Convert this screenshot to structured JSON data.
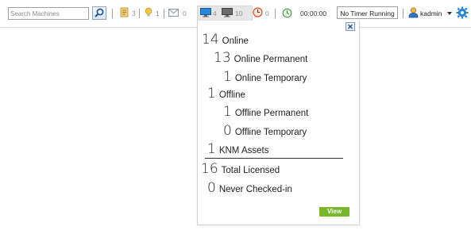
{
  "toolbar": {
    "search": {
      "placeholder": "Search Machines",
      "value": ""
    },
    "counters": {
      "notes": "3",
      "alerts": "1",
      "mail": "0",
      "online_machines": "4",
      "offline_machines": "10",
      "reminders": "0"
    },
    "timer": {
      "elapsed": "00:00:00",
      "status": "No Timer Running"
    },
    "user": {
      "name": "kadmin"
    }
  },
  "machine_summary": {
    "rows": [
      {
        "value": "14",
        "label": "Online"
      },
      {
        "value": "13",
        "label": "Online Permanent"
      },
      {
        "value": "1",
        "label": "Online Temporary"
      },
      {
        "value": "1",
        "label": "Offline"
      },
      {
        "value": "1",
        "label": "Offline Permanent"
      },
      {
        "value": "0",
        "label": "Offline Temporary"
      },
      {
        "value": "1",
        "label": "KNM Assets"
      },
      {
        "value": "16",
        "label": "Total Licensed"
      },
      {
        "value": "0",
        "label": "Never Checked-in"
      }
    ],
    "view_label": "View"
  },
  "colors": {
    "view_button": "#76b82a",
    "highlight": "#e6e6e6",
    "accent_blue": "#1f6fc5"
  },
  "icons": [
    "search-icon",
    "notes-icon",
    "lightbulb-icon",
    "mail-icon",
    "monitor-icon",
    "monitor-offline-icon",
    "clock-icon",
    "timer-icon",
    "user-icon",
    "gear-icon",
    "close-icon"
  ]
}
